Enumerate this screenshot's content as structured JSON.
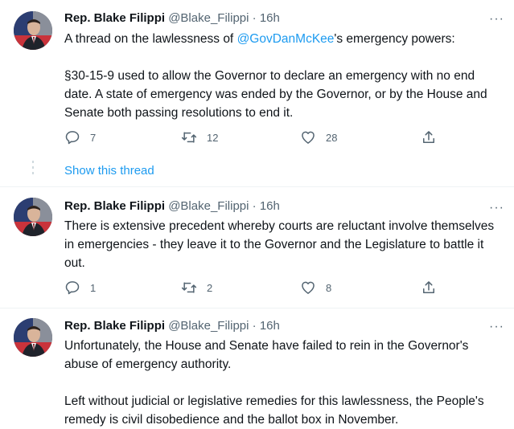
{
  "tweets": [
    {
      "name": "Rep. Blake Filippi",
      "handle": "@Blake_Filippi",
      "dot": "·",
      "time": "16h",
      "text_before": "A thread on the lawlessness of ",
      "mention": "@GovDanMcKee",
      "text_after": "'s emergency powers:",
      "paragraph2": "§30-15-9 used to allow the Governor to declare an emergency with no end date. A state of emergency was ended by the Governor, or by the House and Senate both passing resolutions to end it.",
      "replies": "7",
      "retweets": "12",
      "likes": "28"
    },
    {
      "name": "Rep. Blake Filippi",
      "handle": "@Blake_Filippi",
      "dot": "·",
      "time": "16h",
      "paragraph1": "There is extensive precedent whereby courts are reluctant involve themselves in emergencies - they leave it to the Governor and the Legislature to battle it out.",
      "replies": "1",
      "retweets": "2",
      "likes": "8"
    },
    {
      "name": "Rep. Blake Filippi",
      "handle": "@Blake_Filippi",
      "dot": "·",
      "time": "16h",
      "paragraph1": "Unfortunately, the House and Senate have failed to rein in the Governor's abuse of emergency authority.",
      "paragraph2": "Left without judicial or legislative remedies for this lawlessness, the People's remedy is civil disobedience and the ballot box in November."
    }
  ],
  "show_thread": "Show this thread",
  "more_glyph": "···",
  "colors": {
    "accent": "#1d9bf0",
    "muted": "#536471",
    "text": "#0f1419"
  },
  "icons": {
    "reply": "reply-icon",
    "retweet": "retweet-icon",
    "like": "heart-icon",
    "share": "share-icon",
    "more": "more-icon"
  }
}
